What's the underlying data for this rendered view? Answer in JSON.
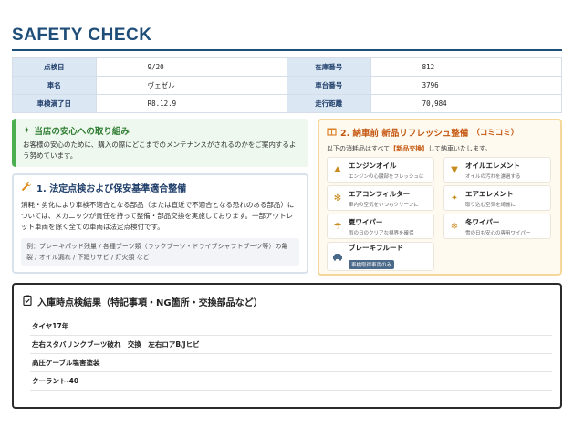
{
  "header": {
    "title": "SAFETY CHECK"
  },
  "info_table": {
    "rows": [
      {
        "l1": "点検日",
        "v1": "9/20",
        "l2": "在庫番号",
        "v2": "812"
      },
      {
        "l1": "車名",
        "v1": "ヴェゼル",
        "l2": "車台番号",
        "v2": "3796"
      },
      {
        "l1": "車検満了日",
        "v1": "R8.12.9",
        "l2": "走行距離",
        "v2": "70,984"
      }
    ]
  },
  "store_card": {
    "icon": "handshake-icon",
    "title": "当店の安心への取り組み",
    "body": "お客様の安心のために、購入の際にどこまでのメンテナンスがされるのかをご案内するよう努めています。"
  },
  "legal_card": {
    "icon": "wrench-icon",
    "title": "1. 法定点検および保安基準適合整備",
    "body": "消耗・劣化により車検不適合となる部品（または直近で不適合となる恐れのある部品）については、メカニックが責任を持って整備・部品交換を実施しております。一部アウトレット車両を除く全ての車両は法定点検付です。",
    "example": "例：ブレーキパッド残量 / 各種ブーツ類（ラックブーツ・ドライブシャフトブーツ等）の亀裂 / オイル漏れ / 下廻りサビ / 灯火類 など"
  },
  "refresh_card": {
    "icon": "gift-icon",
    "title": "2. 納車前 新品リフレッシュ整備",
    "title_note": "（コミコミ）",
    "intro_pre": "以下の消耗品はすべて",
    "intro_em": "【新品交換】",
    "intro_post": "して納車いたします。",
    "items": [
      {
        "icon": "oil-can-icon",
        "name": "エンジンオイル",
        "desc": "エンジンの心臓部をフレッシュに"
      },
      {
        "icon": "filter-icon",
        "name": "オイルエレメント",
        "desc": "オイルの汚れを濾過する"
      },
      {
        "icon": "fan-icon",
        "name": "エアコンフィルター",
        "desc": "車内の空気をいつもクリーンに"
      },
      {
        "icon": "element-icon",
        "name": "エアエレメント",
        "desc": "取り込む空気を綺麗に"
      },
      {
        "icon": "rain-icon",
        "name": "夏ワイパー",
        "desc": "雨の日のクリアな視界を確保"
      },
      {
        "icon": "snowflake-icon",
        "name": "冬ワイパー",
        "desc": "雪の日も安心の専用ワイパー"
      },
      {
        "icon": "car-icon",
        "name": "ブレーキフルード",
        "badge": "車検取得車両のみ"
      }
    ]
  },
  "result_card": {
    "icon": "clipboard-check-icon",
    "title": "入庫時点検結果（特記事項・NG箇所・交換部品など）",
    "rows": [
      "タイヤ17年",
      "左右スタバリンクブーツ破れ　交換　左右ロアB/Jヒビ",
      "高圧ケーブル塩害塗装",
      "クーラント-40"
    ]
  }
}
